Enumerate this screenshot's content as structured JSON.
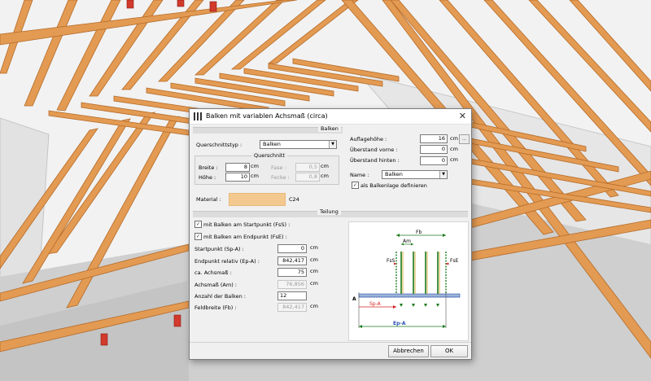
{
  "window": {
    "title": "Balken mit variablen Achsmaß (circa)",
    "close_glyph": "✕"
  },
  "sections": {
    "balken": "Balken",
    "querschnitt": "Querschnitt",
    "teilung": "Teilung"
  },
  "querschnittstyp": {
    "label": "Querschnittstyp :",
    "value": "Balken"
  },
  "breite": {
    "label": "Breite :",
    "value": "8",
    "unit": "cm"
  },
  "hoehe": {
    "label": "Höhe :",
    "value": "10",
    "unit": "cm"
  },
  "fase": {
    "label": "Fase :",
    "value": "0,5",
    "unit": "cm"
  },
  "fecke": {
    "label": "Fecke :",
    "value": "0,8",
    "unit": "cm"
  },
  "auflagehoehe": {
    "label": "Auflagehöhe :",
    "value": "16",
    "unit": "cm"
  },
  "ueberstand_vorne": {
    "label": "Überstand vorne :",
    "value": "0",
    "unit": "cm"
  },
  "ueberstand_hinten": {
    "label": "Überstand hinten :",
    "value": "0",
    "unit": "cm"
  },
  "name": {
    "label": "Name :",
    "value": "Balken"
  },
  "als_balkenlage": {
    "label": "als Balkenlage definieren",
    "checked": true
  },
  "material": {
    "label": "Material :",
    "value": "C24",
    "color": "#f4c98f"
  },
  "mit_balken_start": {
    "label": "mit Balken am Startpunkt (FsS) :",
    "checked": true
  },
  "mit_balken_end": {
    "label": "mit Balken am Endpunkt (FsE) :",
    "checked": true
  },
  "startpunkt": {
    "label": "Startpunkt  (Sp-A) :",
    "value": "0",
    "unit": "cm"
  },
  "endpunkt": {
    "label": "Endpunkt relativ  (Ep-A) :",
    "value": "842,417",
    "unit": "cm"
  },
  "achsmass": {
    "label": "ca. Achsmaß :",
    "value": "75",
    "unit": "cm"
  },
  "achsmass_am": {
    "label": "Achsmaß (Am) :",
    "value": "76,856",
    "unit": "cm"
  },
  "anzahl": {
    "label": "Anzahl der Balken :",
    "value": "12"
  },
  "feldbreite": {
    "label": "Feldbreite (Fb) :",
    "value": "842,417",
    "unit": "cm"
  },
  "diagram": {
    "fb": "Fb",
    "am": "Am",
    "fss": "FsS",
    "fse": "FsE",
    "spa": "Sp-A",
    "epa": "Ep-A",
    "a": "A",
    "arrow_color": "#1c7a1c",
    "red": "#d42020",
    "blue": "#2a4fb0"
  },
  "buttons": {
    "cancel": "Abbrechen",
    "ok": "OK",
    "more": "..."
  },
  "colors": {
    "timber": "#e39a52",
    "timber_dark": "#b56c2a",
    "bracket": "#d23a2c"
  }
}
